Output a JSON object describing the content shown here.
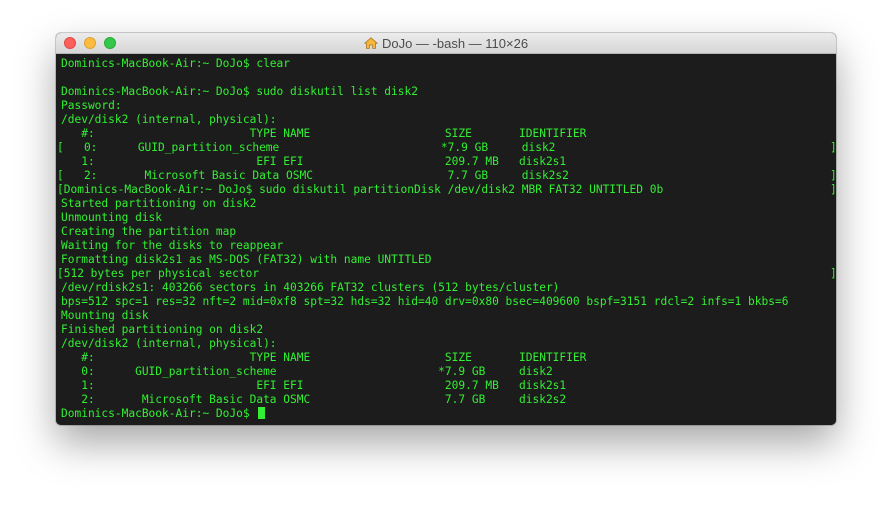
{
  "window": {
    "title": "DoJo — -bash — 110×26",
    "title_icon": "home-icon"
  },
  "terminal": {
    "lines": [
      "Dominics-MacBook-Air:~ DoJo$ clear",
      "",
      "Dominics-MacBook-Air:~ DoJo$ sudo diskutil list disk2",
      "Password:",
      "/dev/disk2 (internal, physical):",
      "   #:                       TYPE NAME                    SIZE       IDENTIFIER",
      "[   0:      GUID_partition_scheme                        *7.9 GB     disk2",
      "   1:                        EFI EFI                     209.7 MB   disk2s1",
      "[   2:       Microsoft Basic Data OSMC                    7.7 GB     disk2s2",
      "[Dominics-MacBook-Air:~ DoJo$ sudo diskutil partitionDisk /dev/disk2 MBR FAT32 UNTITLED 0b",
      "Started partitioning on disk2",
      "Unmounting disk",
      "Creating the partition map",
      "Waiting for the disks to reappear",
      "Formatting disk2s1 as MS-DOS (FAT32) with name UNTITLED",
      "[512 bytes per physical sector",
      "/dev/rdisk2s1: 403266 sectors in 403266 FAT32 clusters (512 bytes/cluster)",
      "bps=512 spc=1 res=32 nft=2 mid=0xf8 spt=32 hds=32 hid=40 drv=0x80 bsec=409600 bspf=3151 rdcl=2 infs=1 bkbs=6",
      "Mounting disk",
      "Finished partitioning on disk2",
      "/dev/disk2 (internal, physical):",
      "   #:                       TYPE NAME                    SIZE       IDENTIFIER",
      "   0:      GUID_partition_scheme                        *7.9 GB     disk2",
      "   1:                        EFI EFI                     209.7 MB   disk2s1",
      "   2:       Microsoft Basic Data OSMC                    7.7 GB     disk2s2",
      "Dominics-MacBook-Air:~ DoJo$ "
    ],
    "right_bracket": "]",
    "text_color": "#33ef33",
    "background_color": "#1c1c1c"
  }
}
